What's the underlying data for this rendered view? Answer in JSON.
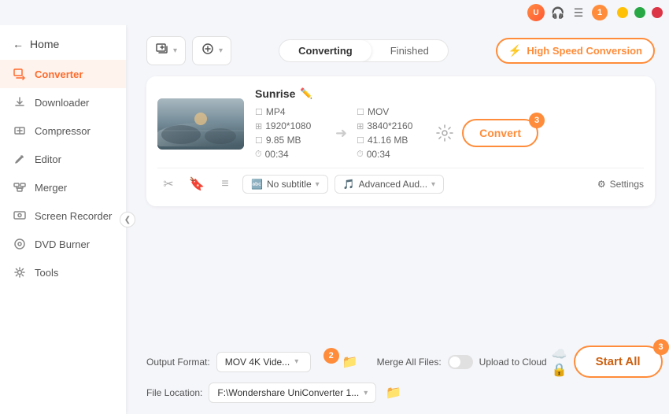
{
  "titlebar": {
    "win_minimize": "–",
    "win_maximize": "□",
    "win_close": "✕"
  },
  "sidebar": {
    "back_label": "Home",
    "items": [
      {
        "id": "converter",
        "label": "Converter",
        "icon": "⧉",
        "active": true
      },
      {
        "id": "downloader",
        "label": "Downloader",
        "icon": "⬇",
        "active": false
      },
      {
        "id": "compressor",
        "label": "Compressor",
        "icon": "⤓",
        "active": false
      },
      {
        "id": "editor",
        "label": "Editor",
        "icon": "✂",
        "active": false
      },
      {
        "id": "merger",
        "label": "Merger",
        "icon": "⊞",
        "active": false
      },
      {
        "id": "screen-recorder",
        "label": "Screen Recorder",
        "icon": "⏺",
        "active": false
      },
      {
        "id": "dvd-burner",
        "label": "DVD Burner",
        "icon": "💿",
        "active": false
      },
      {
        "id": "tools",
        "label": "Tools",
        "icon": "⚙",
        "active": false
      }
    ]
  },
  "tabs": {
    "converting": "Converting",
    "finished": "Finished",
    "active": "converting"
  },
  "toolbar": {
    "add_files_label": "Add Files",
    "add_more_label": "Add",
    "high_speed_label": "High Speed Conversion",
    "bolt": "⚡"
  },
  "file": {
    "title": "Sunrise",
    "input": {
      "format": "MP4",
      "resolution": "1920*1080",
      "size": "9.85 MB",
      "duration": "00:34"
    },
    "output": {
      "format": "MOV",
      "resolution": "3840*2160",
      "size": "41.16 MB",
      "duration": "00:34"
    },
    "convert_btn": "Convert"
  },
  "footer": {
    "subtitle": "No subtitle",
    "audio": "Advanced Aud...",
    "settings": "Settings"
  },
  "bottom": {
    "output_label": "Output Format:",
    "output_value": "MOV 4K Vide...",
    "location_label": "File Location:",
    "location_value": "F:\\Wondershare UniConverter 1...",
    "merge_label": "Merge All Files:",
    "upload_label": "Upload to Cloud",
    "start_all": "Start All",
    "badge_2": "2",
    "badge_3": "3"
  },
  "badges": {
    "notification": "1",
    "convert_badge": "3",
    "start_badge": "3"
  }
}
